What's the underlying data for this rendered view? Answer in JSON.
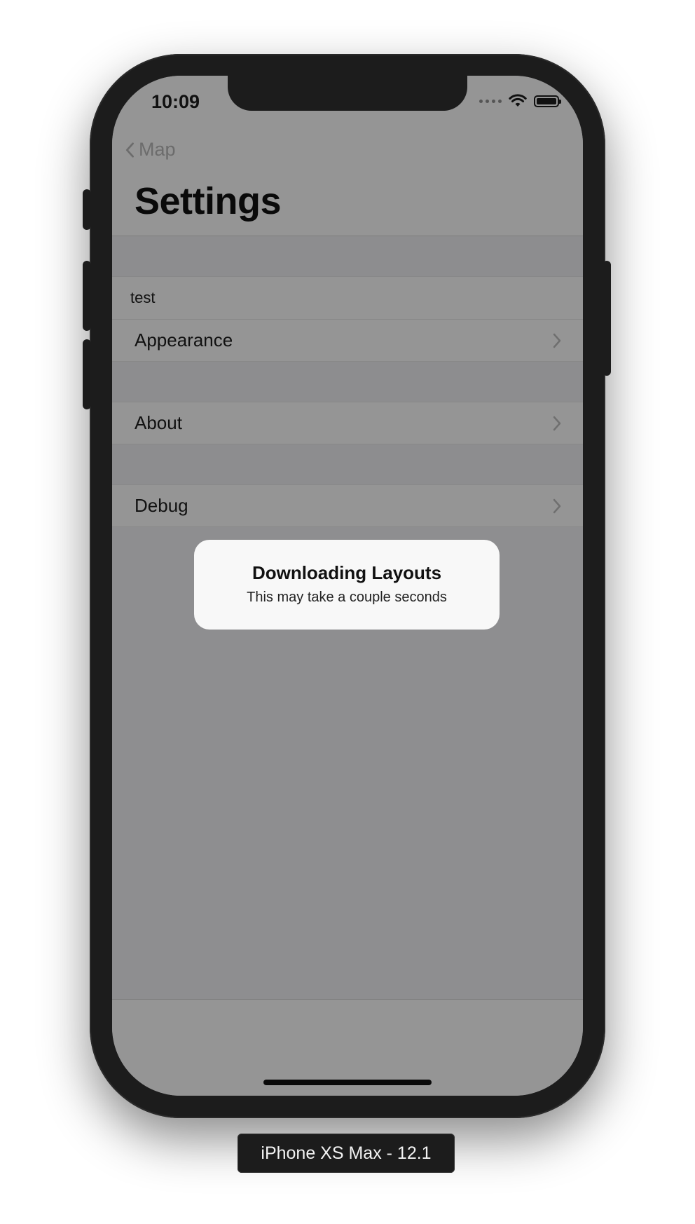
{
  "status_bar": {
    "time": "10:09"
  },
  "nav": {
    "back_label": "Map",
    "title": "Settings"
  },
  "sections": [
    {
      "header": "test",
      "rows": [
        {
          "label": "Appearance"
        }
      ]
    },
    {
      "rows": [
        {
          "label": "About"
        }
      ]
    },
    {
      "rows": [
        {
          "label": "Debug"
        }
      ]
    }
  ],
  "hud": {
    "title": "Downloading Layouts",
    "subtitle": "This may take a couple seconds"
  },
  "device_label": "iPhone XS Max - 12.1",
  "icons": [
    "chevron-left-icon",
    "chevron-right-icon",
    "wifi-icon",
    "battery-icon",
    "signal-icon"
  ]
}
